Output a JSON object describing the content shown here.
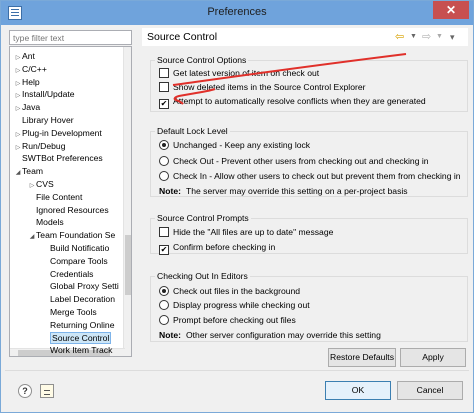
{
  "window": {
    "title": "Preferences"
  },
  "sidebar": {
    "filter_placeholder": "type filter text",
    "items": [
      {
        "label": "Ant",
        "level": 0,
        "expander": "collapsed"
      },
      {
        "label": "C/C++",
        "level": 0,
        "expander": "collapsed"
      },
      {
        "label": "Help",
        "level": 0,
        "expander": "collapsed"
      },
      {
        "label": "Install/Update",
        "level": 0,
        "expander": "collapsed"
      },
      {
        "label": "Java",
        "level": 0,
        "expander": "collapsed"
      },
      {
        "label": "Library Hover",
        "level": 0,
        "expander": "none"
      },
      {
        "label": "Plug-in Development",
        "level": 0,
        "expander": "collapsed"
      },
      {
        "label": "Run/Debug",
        "level": 0,
        "expander": "collapsed"
      },
      {
        "label": "SWTBot Preferences",
        "level": 0,
        "expander": "none"
      },
      {
        "label": "Team",
        "level": 0,
        "expander": "expanded"
      },
      {
        "label": "CVS",
        "level": 1,
        "expander": "collapsed"
      },
      {
        "label": "File Content",
        "level": 1,
        "expander": "none"
      },
      {
        "label": "Ignored Resources",
        "level": 1,
        "expander": "none"
      },
      {
        "label": "Models",
        "level": 1,
        "expander": "none"
      },
      {
        "label": "Team Foundation Se",
        "level": 1,
        "expander": "expanded"
      },
      {
        "label": "Build Notificatio",
        "level": 2,
        "expander": "none"
      },
      {
        "label": "Compare Tools",
        "level": 2,
        "expander": "none"
      },
      {
        "label": "Credentials",
        "level": 2,
        "expander": "none"
      },
      {
        "label": "Global Proxy Setti",
        "level": 2,
        "expander": "none"
      },
      {
        "label": "Label Decoration",
        "level": 2,
        "expander": "none"
      },
      {
        "label": "Merge Tools",
        "level": 2,
        "expander": "none"
      },
      {
        "label": "Returning Online",
        "level": 2,
        "expander": "none"
      },
      {
        "label": "Source Control",
        "level": 2,
        "expander": "none",
        "selected": true
      },
      {
        "label": "Work Item Track",
        "level": 2,
        "expander": "none"
      }
    ]
  },
  "main": {
    "title": "Source Control",
    "source_control_options": {
      "title": "Source Control Options",
      "options": [
        {
          "label": "Get latest version of item on check out",
          "checked": false
        },
        {
          "label": "Show deleted items in the Source Control Explorer",
          "checked": false
        },
        {
          "label": "Attempt to automatically resolve conflicts when they are generated",
          "checked": true
        }
      ]
    },
    "default_lock_level": {
      "title": "Default Lock Level",
      "options": [
        {
          "label": "Unchanged - Keep any existing lock",
          "selected": true
        },
        {
          "label": "Check Out - Prevent other users from checking out and checking in",
          "selected": false
        },
        {
          "label": "Check In - Allow other users to check out but prevent them from checking in",
          "selected": false
        }
      ],
      "note_label": "Note:",
      "note_text": "The server may override this setting on a per-project basis"
    },
    "source_control_prompts": {
      "title": "Source Control Prompts",
      "options": [
        {
          "label": "Hide the \"All files are up to date\" message",
          "checked": false
        },
        {
          "label": "Confirm before checking in",
          "checked": true
        }
      ]
    },
    "checking_out": {
      "title": "Checking Out In Editors",
      "options": [
        {
          "label": "Check out files in the background",
          "selected": true
        },
        {
          "label": "Display progress while checking out",
          "selected": false
        },
        {
          "label": "Prompt before checking out files",
          "selected": false
        }
      ],
      "note_label": "Note:",
      "note_text": "Other server configuration may override this setting"
    },
    "restore_defaults": "Restore Defaults",
    "apply": "Apply"
  },
  "footer": {
    "ok": "OK",
    "cancel": "Cancel"
  },
  "icons": {
    "back": "back-arrow-icon",
    "forward": "forward-arrow-icon",
    "help": "help-icon",
    "import": "import-export-icon"
  },
  "colors": {
    "titlebar": "#6fa3dc",
    "close": "#c75050",
    "selection": "#cde6f7",
    "annotation": "#e0302a"
  }
}
